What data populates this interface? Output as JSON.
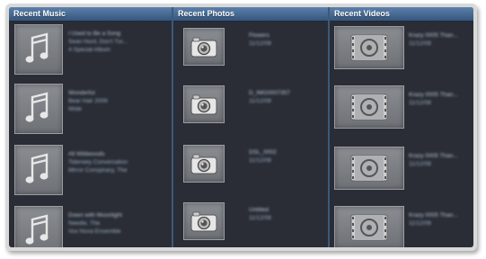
{
  "columns": {
    "music": {
      "title": "Recent Music"
    },
    "photos": {
      "title": "Recent Photos"
    },
    "videos": {
      "title": "Recent Videos"
    }
  },
  "music_items": [
    {
      "icon": "music-note-icon",
      "lines": [
        "I Used to Be a Song",
        "Sean Hurd, Don't Tur...",
        "A Special Album"
      ]
    },
    {
      "icon": "music-note-icon",
      "lines": [
        "Wonderful",
        "Bear Hair 2009",
        "Wide"
      ]
    },
    {
      "icon": "music-note-icon",
      "lines": [
        "All Wildwoods",
        "Tiderwey Conversation",
        "Mirror Conspiracy, The"
      ]
    },
    {
      "icon": "music-note-icon",
      "lines": [
        "Down with Moonlight",
        "Needle, The",
        "Vox Nova Ensemble"
      ]
    }
  ],
  "photo_items": [
    {
      "icon": "camera-icon",
      "lines": [
        "Flowers",
        "11/12/08"
      ]
    },
    {
      "icon": "camera-icon",
      "lines": [
        "D_IMG0007357",
        "11/12/08"
      ]
    },
    {
      "icon": "camera-icon",
      "lines": [
        "DSL_0002",
        "11/12/08"
      ]
    },
    {
      "icon": "camera-icon",
      "lines": [
        "Untitled",
        "11/12/08"
      ]
    }
  ],
  "video_items": [
    {
      "icon": "film-reel-icon",
      "lines": [
        "Krazy 0005 Than...",
        "11/12/08"
      ]
    },
    {
      "icon": "film-reel-icon",
      "lines": [
        "Krazy 0005 Than...",
        "11/12/08"
      ]
    },
    {
      "icon": "film-reel-icon",
      "lines": [
        "Krazy 0005 Than...",
        "11/12/08"
      ]
    },
    {
      "icon": "film-reel-icon",
      "lines": [
        "Krazy 0005 Than...",
        "11/12/08"
      ]
    }
  ]
}
